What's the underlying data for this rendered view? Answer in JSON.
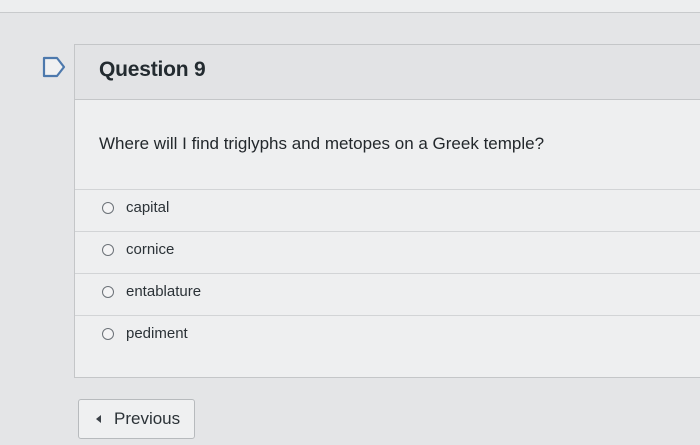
{
  "question": {
    "title": "Question 9",
    "text": "Where will I find triglyphs and metopes on a Greek temple?",
    "flag_icon": "flag-bookmark-icon",
    "answers": [
      {
        "label": "capital"
      },
      {
        "label": "cornice"
      },
      {
        "label": "entablature"
      },
      {
        "label": "pediment"
      }
    ]
  },
  "navigation": {
    "previous_label": "Previous",
    "previous_icon": "caret-left-icon"
  }
}
